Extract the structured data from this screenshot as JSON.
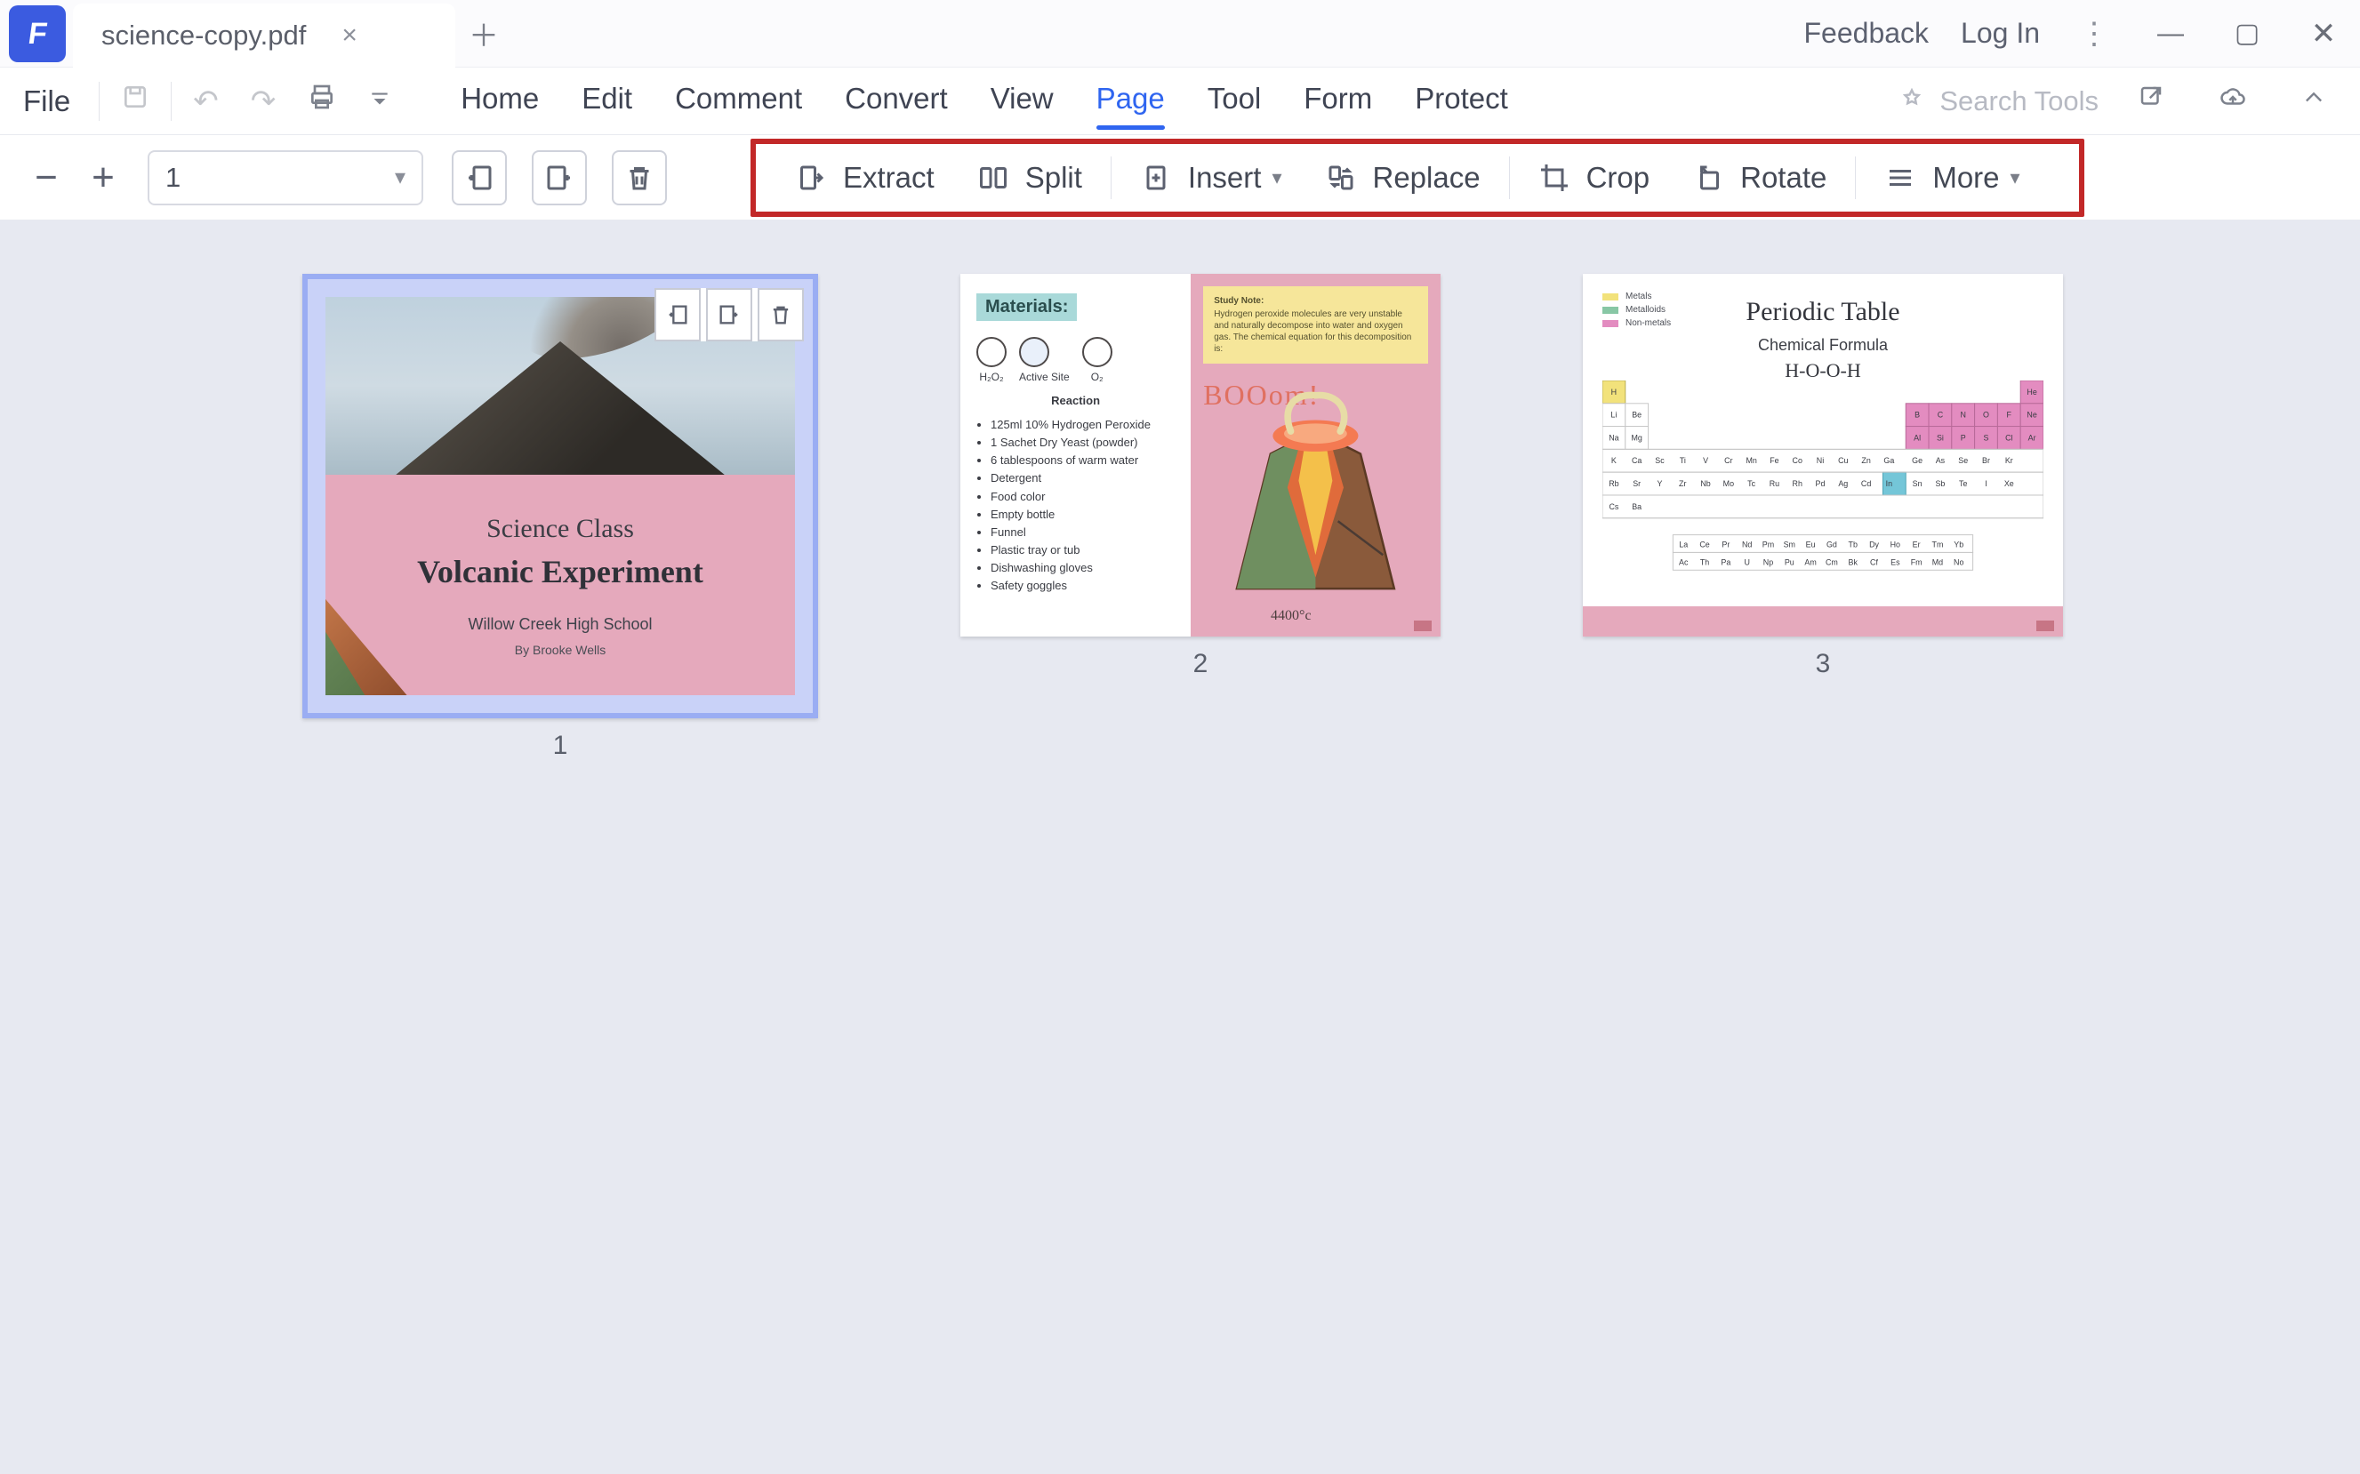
{
  "titlebar": {
    "tab_title": "science-copy.pdf",
    "feedback": "Feedback",
    "login": "Log In"
  },
  "menu": {
    "file": "File",
    "items": [
      "Home",
      "Edit",
      "Comment",
      "Convert",
      "View",
      "Page",
      "Tool",
      "Form",
      "Protect"
    ],
    "active_index": 5,
    "search_placeholder": "Search Tools"
  },
  "pagebar": {
    "current_page": "1",
    "actions": {
      "extract": "Extract",
      "split": "Split",
      "insert": "Insert",
      "replace": "Replace",
      "crop": "Crop",
      "rotate": "Rotate",
      "more": "More"
    }
  },
  "thumbnails": [
    {
      "number": "1",
      "selected": true
    },
    {
      "number": "2",
      "selected": false
    },
    {
      "number": "3",
      "selected": false
    }
  ],
  "page1": {
    "line1": "Science Class",
    "line2": "Volcanic Experiment",
    "line3": "Willow Creek High School",
    "line4": "By Brooke Wells"
  },
  "page2": {
    "materials_label": "Materials:",
    "reaction_label": "Reaction",
    "atoms_row": [
      "H₂O₂",
      "Active Site",
      "O₂"
    ],
    "list": [
      "125ml 10% Hydrogen Peroxide",
      "1 Sachet Dry Yeast (powder)",
      "6 tablespoons of warm water",
      "Detergent",
      "Food color",
      "Empty bottle",
      "Funnel",
      "Plastic tray or tub",
      "Dishwashing gloves",
      "Safety goggles"
    ],
    "note_title": "Study Note:",
    "note_body": "Hydrogen peroxide molecules are very unstable and naturally decompose into water and oxygen gas. The chemical equation for this decomposition is:",
    "boom": "BOOom!",
    "temperature": "4400°c"
  },
  "page3": {
    "title": "Periodic Table",
    "subtitle": "Chemical Formula",
    "formula": "H-O-O-H",
    "legend": [
      {
        "color": "#f2e27b",
        "label": "Metals"
      },
      {
        "color": "#88c7a5",
        "label": "Metalloids"
      },
      {
        "color": "#e38cc0",
        "label": "Non-metals"
      }
    ]
  }
}
